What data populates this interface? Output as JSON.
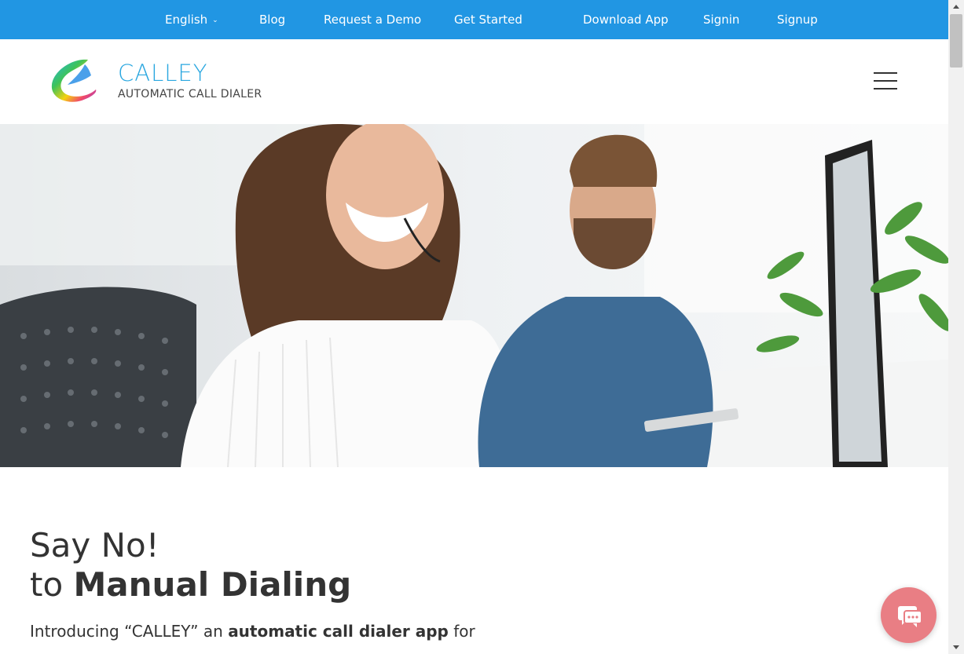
{
  "topnav": {
    "language": "English",
    "links": [
      "Blog",
      "Request a Demo",
      "Get Started",
      "Download App",
      "Signin",
      "Signup"
    ]
  },
  "brand": {
    "name": "CALLEY",
    "tagline": "AUTOMATIC CALL DIALER",
    "accent_color": "#2aa7e0"
  },
  "hero": {
    "image_subject": "call center agents wearing headsets at desks"
  },
  "headline": {
    "line1": "Say No!",
    "line2_prefix": "to ",
    "line2_bold": "Manual Dialing"
  },
  "intro": {
    "prefix": "Introducing “CALLEY” an ",
    "bold": "automatic call dialer app",
    "suffix": " for"
  },
  "colors": {
    "nav_bg": "#2196e3",
    "chat_bg": "#e97e84"
  },
  "icons": {
    "chat": "chat-bubble-icon",
    "menu": "hamburger-menu-icon",
    "language_dropdown": "chevron-down-icon"
  }
}
